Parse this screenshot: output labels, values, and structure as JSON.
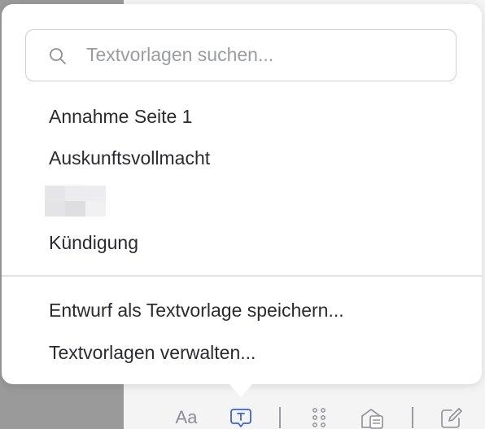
{
  "search": {
    "placeholder": "Textvorlagen suchen..."
  },
  "templates": [
    {
      "label": "Annahme Seite 1"
    },
    {
      "label": "Auskunftsvollmacht"
    },
    {
      "label": ""
    },
    {
      "label": "Kündigung"
    }
  ],
  "actions": {
    "save_draft": "Entwurf als Textvorlage speichern...",
    "manage": "Textvorlagen verwalten..."
  },
  "toolbar": {
    "font_label": "Aa",
    "icons": [
      "font-format-icon",
      "text-template-icon",
      "grid-dots-icon",
      "envelope-document-icon",
      "edit-icon"
    ]
  },
  "colors": {
    "accent": "#3b63d6",
    "text": "#2a2a33",
    "placeholder": "#9b9ca3",
    "toolbar_icon": "#8d8d96"
  }
}
